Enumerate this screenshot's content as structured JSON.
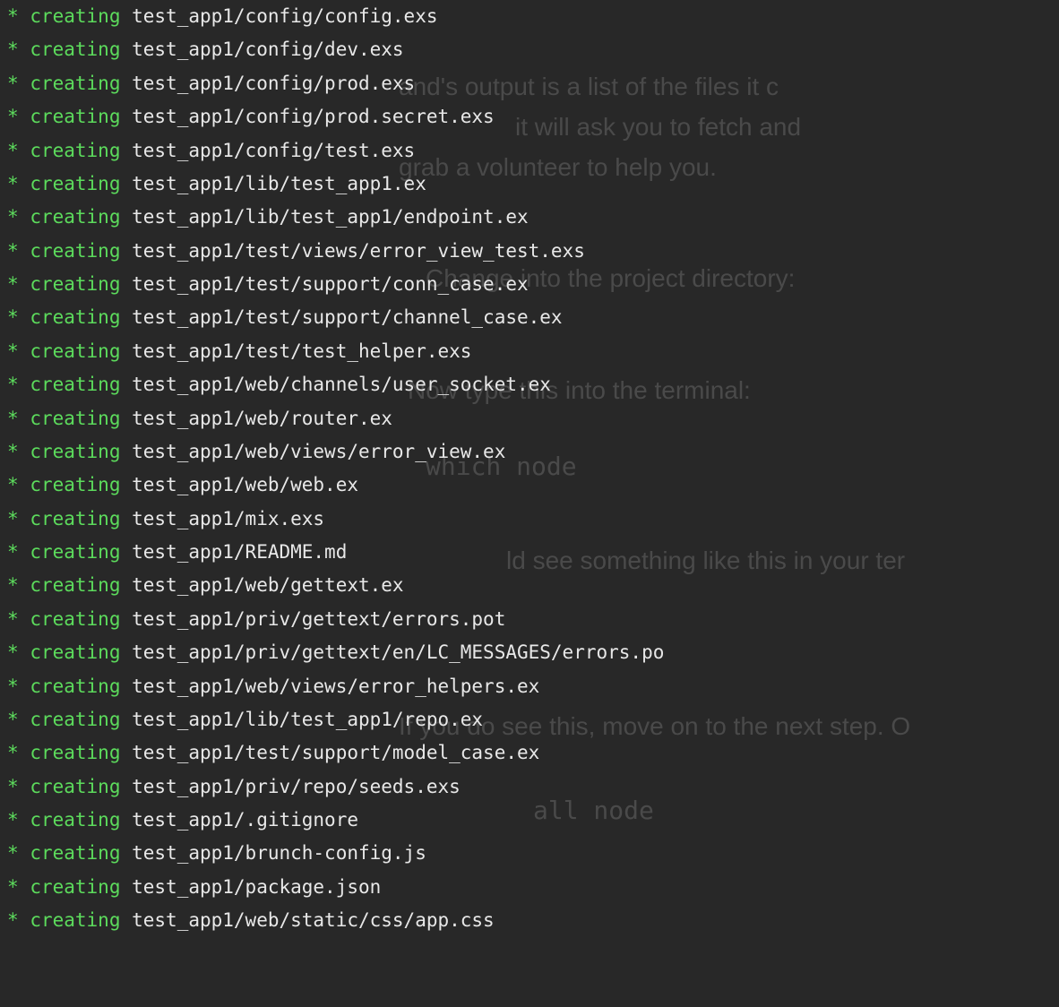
{
  "terminal": {
    "asterisk": "*",
    "action": "creating",
    "lines": [
      "test_app1/config/config.exs",
      "test_app1/config/dev.exs",
      "test_app1/config/prod.exs",
      "test_app1/config/prod.secret.exs",
      "test_app1/config/test.exs",
      "test_app1/lib/test_app1.ex",
      "test_app1/lib/test_app1/endpoint.ex",
      "test_app1/test/views/error_view_test.exs",
      "test_app1/test/support/conn_case.ex",
      "test_app1/test/support/channel_case.ex",
      "test_app1/test/test_helper.exs",
      "test_app1/web/channels/user_socket.ex",
      "test_app1/web/router.ex",
      "test_app1/web/views/error_view.ex",
      "test_app1/web/web.ex",
      "test_app1/mix.exs",
      "test_app1/README.md",
      "test_app1/web/gettext.ex",
      "test_app1/priv/gettext/errors.pot",
      "test_app1/priv/gettext/en/LC_MESSAGES/errors.po",
      "test_app1/web/views/error_helpers.ex",
      "test_app1/lib/test_app1/repo.ex",
      "test_app1/test/support/model_case.ex",
      "test_app1/priv/repo/seeds.exs",
      "test_app1/.gitignore",
      "test_app1/brunch-config.js",
      "test_app1/package.json",
      "test_app1/web/static/css/app.css"
    ]
  },
  "background": {
    "line1": "and's output is a list of the files it c",
    "line2": "it will ask you to fetch and",
    "line3": "grab a volunteer to help you.",
    "line4": "Change into the project directory:",
    "line5": "Now type this into the terminal:",
    "line6": "which node",
    "line7": "ld see something like this in your ter",
    "line8": "If you do see this, move on to the next step. O",
    "line9": "all node"
  }
}
